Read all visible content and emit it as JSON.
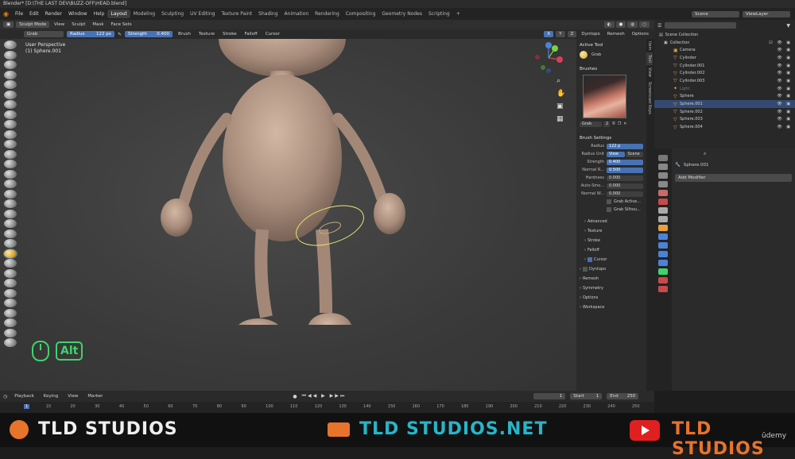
{
  "window": {
    "title": "Blender* [D:\\THE LAST DEV\\BUZZ-OFF\\HEAD.blend]"
  },
  "menu": [
    "File",
    "Edit",
    "Render",
    "Window",
    "Help"
  ],
  "workspaces": [
    "Layout",
    "Modeling",
    "Sculpting",
    "UV Editing",
    "Texture Paint",
    "Shading",
    "Animation",
    "Rendering",
    "Compositing",
    "Geometry Nodes",
    "Scripting"
  ],
  "active_workspace": "Layout",
  "scene": {
    "scene_name": "Scene",
    "view_layer": "ViewLayer"
  },
  "viewport_header": {
    "mode": "Sculpt Mode",
    "items": [
      "View",
      "Sculpt",
      "Mask",
      "Face Sets"
    ]
  },
  "tool_header": {
    "tool_name": "Grab",
    "radius_label": "Radius",
    "radius_value": "122 px",
    "strength_label": "Strength",
    "strength_value": "0.400",
    "menus": [
      "Brush",
      "Texture",
      "Stroke",
      "Falloff",
      "Cursor"
    ],
    "right_menus": [
      "Dyntopo",
      "Remesh",
      "Options"
    ],
    "axes": [
      "X",
      "Y",
      "Z"
    ]
  },
  "viewport": {
    "perspective": "User Perspective",
    "object": "(1) Sphere.001",
    "key_hint": "Alt"
  },
  "npanel": {
    "active_tool_title": "Active Tool",
    "active_tool_name": "Grab",
    "brushes_title": "Brushes",
    "brush_name": "Grab",
    "brush_users": "2",
    "brush_settings_title": "Brush Settings",
    "rows": [
      {
        "label": "Radius",
        "value": "122 p"
      },
      {
        "label": "Radius Unit",
        "value": "View",
        "value2": "Scene"
      },
      {
        "label": "Strength",
        "value": "0.400"
      },
      {
        "label": "Normal R...",
        "value": "0.500"
      },
      {
        "label": "Hardness",
        "value": "0.000"
      },
      {
        "label": "Auto-Smo...",
        "value": "0.000"
      },
      {
        "label": "Normal W...",
        "value": "0.000"
      }
    ],
    "checks": [
      "Grab Active...",
      "Grab Silhou..."
    ],
    "sections": [
      "Advanced",
      "Texture",
      "Stroke",
      "Falloff",
      "Cursor",
      "Dyntopo",
      "Remesh",
      "Symmetry",
      "Options",
      "Workspace"
    ],
    "tabs": [
      "Item",
      "Tool",
      "View",
      "Screencast Keys"
    ]
  },
  "outliner": {
    "root": "Scene Collection",
    "collection": "Collection",
    "objects": [
      "Camera",
      "Cylinder",
      "Cylinder.001",
      "Cylinder.002",
      "Cylinder.003",
      "Light",
      "Sphere",
      "Sphere.001",
      "Sphere.002",
      "Sphere.003",
      "Sphere.004"
    ],
    "selected": "Sphere.001"
  },
  "properties": {
    "object_name": "Sphere.001",
    "add_modifier": "Add Modifier"
  },
  "timeline": {
    "menus": [
      "Playback",
      "Keying",
      "View",
      "Marker"
    ],
    "current_frame": "1",
    "start_label": "Start",
    "start": "1",
    "end_label": "End",
    "end": "250",
    "ruler": [
      "1",
      "10",
      "20",
      "30",
      "40",
      "50",
      "60",
      "70",
      "80",
      "90",
      "100",
      "110",
      "120",
      "130",
      "140",
      "150",
      "160",
      "170",
      "180",
      "190",
      "200",
      "210",
      "220",
      "230",
      "240",
      "250"
    ]
  },
  "footer": {
    "brand_left": "TLD STUDIOS",
    "site": "TLD STUDIOS.NET",
    "brand_right": "TLD STUDIOS",
    "udemy": "ūdemy"
  },
  "colors": {
    "accent_blue": "#4772b3",
    "brand_orange": "#e8732a",
    "brand_teal": "#27b5c9",
    "hint_green": "#3ed46a"
  }
}
